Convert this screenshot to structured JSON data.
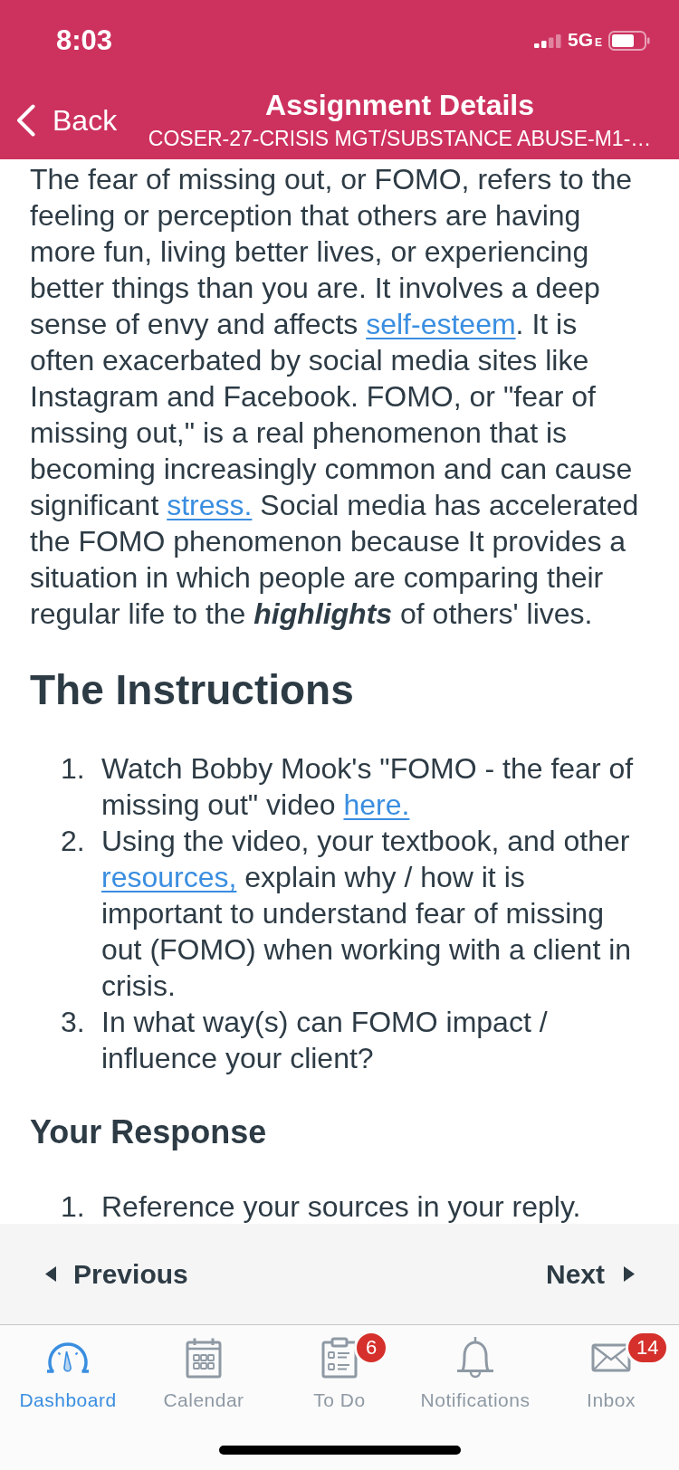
{
  "status_bar": {
    "time": "8:03",
    "network": "5G",
    "network_suffix": "E"
  },
  "header": {
    "back": "Back",
    "title": "Assignment Details",
    "subtitle": "COSER-27-CRISIS MGT/SUBSTANCE ABUSE-M1-…"
  },
  "intro": [
    {
      "kind": "text",
      "text": "The fear of missing out, or FOMO, refers to the feeling or perception that others are having more fun, living better lives, or experiencing better things than you are. It involves a deep sense of envy and affects "
    },
    {
      "kind": "link",
      "text": "self-esteem"
    },
    {
      "kind": "text",
      "text": ". It is often exacerbated by social media sites like Instagram and Facebook. FOMO, or \"fear of missing out,\" is a real phenomenon that is becoming increasingly common and can cause significant "
    },
    {
      "kind": "link",
      "text": "stress."
    },
    {
      "kind": "text",
      "text": " Social media has accelerated the FOMO phenomenon because It provides a situation in which people are comparing their regular life to the "
    },
    {
      "kind": "emphasis",
      "text": "highlights"
    },
    {
      "kind": "text",
      "text": " of others' lives."
    }
  ],
  "sections": [
    {
      "kind": "h2",
      "heading": "The Instructions",
      "items": [
        {
          "number": "1.",
          "segments": [
            {
              "kind": "text",
              "text": "Watch Bobby Mook's \"FOMO - the fear of missing out\" video "
            },
            {
              "kind": "link",
              "text": "here."
            }
          ]
        },
        {
          "number": "2.",
          "segments": [
            {
              "kind": "text",
              "text": "Using the video, your textbook, and other "
            },
            {
              "kind": "link",
              "text": "resources,"
            },
            {
              "kind": "text",
              "text": " explain why / how it is important to understand fear of missing out (FOMO) when working with a client in crisis."
            }
          ]
        },
        {
          "number": "3.",
          "segments": [
            {
              "kind": "text",
              "text": "In what way(s) can FOMO impact / influence your client?"
            }
          ]
        }
      ]
    },
    {
      "kind": "h3",
      "heading": "Your Response",
      "items": [
        {
          "number": "1.",
          "segments": [
            {
              "kind": "text",
              "text": "Reference your sources in your reply."
            }
          ]
        }
      ]
    }
  ],
  "pager": {
    "previous": "Previous",
    "next": "Next"
  },
  "tabs": [
    {
      "label": "Dashboard",
      "selected": true
    },
    {
      "label": "Calendar",
      "selected": false
    },
    {
      "label": "To Do",
      "selected": false,
      "badge": "6"
    },
    {
      "label": "Notifications",
      "selected": false
    },
    {
      "label": "Inbox",
      "selected": false,
      "badge": "14"
    }
  ]
}
